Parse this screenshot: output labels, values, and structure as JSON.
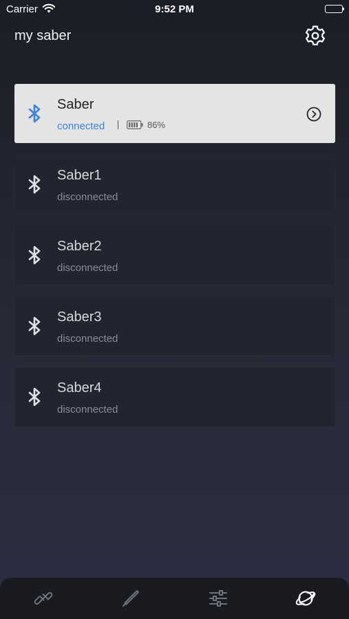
{
  "status_bar": {
    "carrier": "Carrier",
    "time": "9:52 PM"
  },
  "header": {
    "title": "my saber"
  },
  "devices": [
    {
      "name": "Saber",
      "status": "connected",
      "battery": "86%",
      "connected": true
    },
    {
      "name": "Saber1",
      "status": "disconnected",
      "connected": false
    },
    {
      "name": "Saber2",
      "status": "disconnected",
      "connected": false
    },
    {
      "name": "Saber3",
      "status": "disconnected",
      "connected": false
    },
    {
      "name": "Saber4",
      "status": "disconnected",
      "connected": false
    }
  ],
  "tabs": [
    "link-icon",
    "saber-icon",
    "sliders-icon",
    "planet-icon"
  ],
  "colors": {
    "accent": "#3b82e0",
    "card_active_bg": "#e4e4e4",
    "card_bg": "#22242f",
    "tab_bar_bg": "#191b21"
  }
}
